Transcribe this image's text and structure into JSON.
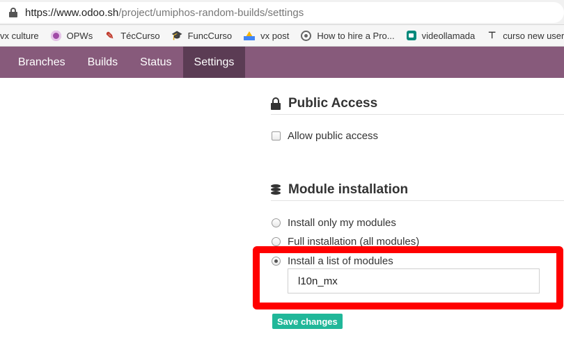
{
  "browser": {
    "url_domain": "https://www.odoo.sh",
    "url_path": "/project/umiphos-random-builds/settings"
  },
  "bookmarks": [
    {
      "label": "vx culture",
      "icon": "none"
    },
    {
      "label": "OPWs",
      "icon": "opws-icon"
    },
    {
      "label": "TécCurso",
      "icon": "tec-icon"
    },
    {
      "label": "FuncCurso",
      "icon": "graduation-cap-icon"
    },
    {
      "label": "vx post",
      "icon": "drive-icon"
    },
    {
      "label": "How to hire a Pro...",
      "icon": "hire-icon"
    },
    {
      "label": "videollamada",
      "icon": "meet-icon"
    },
    {
      "label": "curso new user",
      "icon": "curso-icon"
    }
  ],
  "nav": {
    "tabs": [
      {
        "label": "Branches"
      },
      {
        "label": "Builds"
      },
      {
        "label": "Status"
      },
      {
        "label": "Settings",
        "active": true
      }
    ]
  },
  "public_access": {
    "title": "Public Access",
    "checkbox_label": "Allow public access",
    "checked": false
  },
  "module_installation": {
    "title": "Module installation",
    "options": [
      {
        "label": "Install only my modules",
        "selected": false
      },
      {
        "label": "Full installation (all modules)",
        "selected": false
      },
      {
        "label": "Install a list of modules",
        "selected": true
      }
    ],
    "modules_value": "l10n_mx"
  },
  "save_label": "Save changes",
  "colors": {
    "nav_bg": "#875a7b",
    "nav_active": "#5b3c54",
    "save_button": "#21b799",
    "highlight": "#ff0000"
  }
}
